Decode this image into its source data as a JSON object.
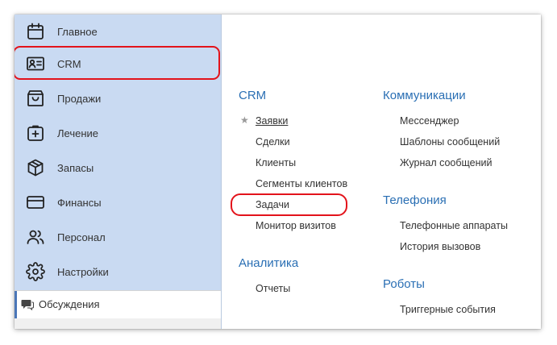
{
  "sidebar": {
    "items": [
      {
        "label": "Главное",
        "icon": "calendar-icon"
      },
      {
        "label": "CRM",
        "icon": "contact-card-icon"
      },
      {
        "label": "Продажи",
        "icon": "shopping-bag-icon"
      },
      {
        "label": "Лечение",
        "icon": "medical-case-icon"
      },
      {
        "label": "Запасы",
        "icon": "box-icon"
      },
      {
        "label": "Финансы",
        "icon": "credit-card-icon"
      },
      {
        "label": "Персонал",
        "icon": "people-icon"
      },
      {
        "label": "Настройки",
        "icon": "gear-icon"
      }
    ],
    "discussions_label": "Обсуждения"
  },
  "content": {
    "crm": {
      "title": "CRM",
      "links": [
        "Заявки",
        "Сделки",
        "Клиенты",
        "Сегменты клиентов",
        "Задачи",
        "Монитор визитов"
      ]
    },
    "analytics": {
      "title": "Аналитика",
      "links": [
        "Отчеты"
      ]
    },
    "communications": {
      "title": "Коммуникации",
      "links": [
        "Мессенджер",
        "Шаблоны сообщений",
        "Журнал сообщений"
      ]
    },
    "telephony": {
      "title": "Телефония",
      "links": [
        "Телефонные аппараты",
        "История вызовов"
      ]
    },
    "robots": {
      "title": "Роботы",
      "links": [
        "Триггерные события"
      ]
    }
  },
  "colors": {
    "sidebar_bg": "#c9daf2",
    "section_title": "#2a6fb4",
    "highlight": "#e3131b"
  }
}
